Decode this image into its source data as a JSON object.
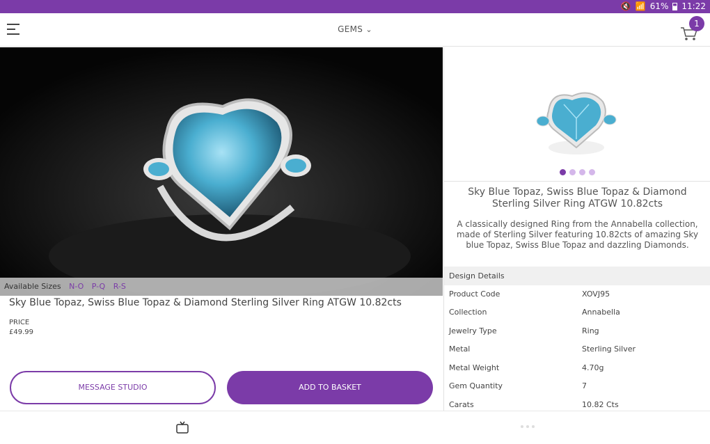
{
  "status_bar": {
    "battery": "61%",
    "time": "11:22"
  },
  "header": {
    "title": "GEMS",
    "cart_count": "1"
  },
  "product": {
    "available_sizes_label": "Available Sizes",
    "sizes": [
      "N-O",
      "P-Q",
      "R-S"
    ],
    "title": "Sky Blue Topaz, Swiss Blue Topaz & Diamond Sterling Silver Ring ATGW 10.82cts",
    "price_label": "PRICE",
    "price": "£49.99",
    "message_button": "MESSAGE STUDIO",
    "basket_button": "ADD TO BASKET"
  },
  "detail_panel": {
    "title": "Sky Blue Topaz, Swiss Blue Topaz & Diamond Sterling Silver Ring ATGW 10.82cts",
    "description": "A classically designed Ring from the Annabella collection, made of Sterling Silver featuring 10.82cts of amazing Sky blue Topaz, Swiss Blue Topaz and dazzling Diamonds.",
    "carousel": {
      "count": 4,
      "active": 0
    },
    "section_title": "Design Details",
    "rows": [
      {
        "label": "Product Code",
        "value": "XOVJ95"
      },
      {
        "label": "Collection",
        "value": "Annabella"
      },
      {
        "label": "Jewelry Type",
        "value": "Ring"
      },
      {
        "label": "Metal",
        "value": "Sterling Silver"
      },
      {
        "label": "Metal Weight",
        "value": "4.70g"
      },
      {
        "label": "Gem Quantity",
        "value": "7"
      },
      {
        "label": "Carats",
        "value": "10.82 Cts"
      }
    ]
  },
  "bottom_nav": {
    "items": [
      "tv-icon",
      "more-icon"
    ]
  },
  "colors": {
    "brand": "#7b3ba8",
    "brand_light": "#d4b7ea",
    "gem": "#4aaed0"
  }
}
